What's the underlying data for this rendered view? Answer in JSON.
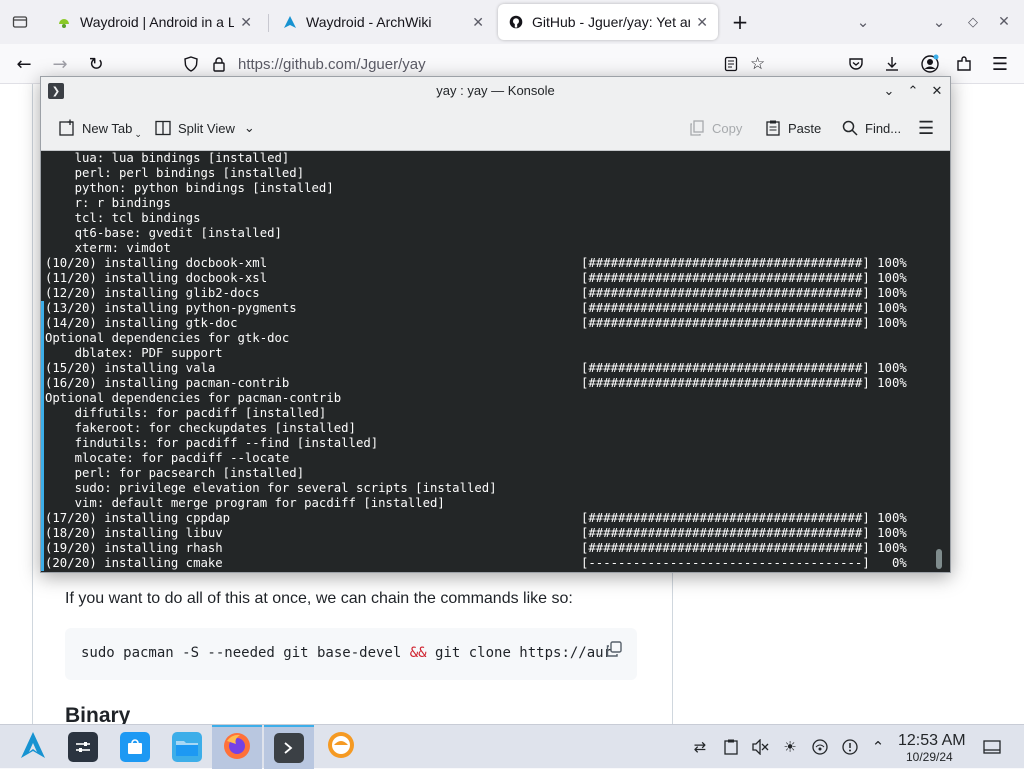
{
  "browser": {
    "tabs": [
      {
        "title": "Waydroid | Android in a Li",
        "favicon": "waydroid-icon",
        "active": false
      },
      {
        "title": "Waydroid - ArchWiki",
        "favicon": "archlinux-icon",
        "active": false
      },
      {
        "title": "GitHub - Jguer/yay: Yet ano",
        "favicon": "github-icon",
        "active": true
      }
    ],
    "url": "https://github.com/Jguer/yay"
  },
  "page": {
    "paragraph": "If you want to do all of this at once, we can chain the commands like so:",
    "code_before": "sudo pacman -S --needed git base-devel ",
    "code_amp": "&&",
    "code_after": " git clone https://aur",
    "heading": "Binary"
  },
  "konsole": {
    "title": "yay : yay — Konsole",
    "toolbar": {
      "new_tab": "New Tab",
      "split_view": "Split View",
      "copy": "Copy",
      "paste": "Paste",
      "find": "Find..."
    },
    "lines": [
      {
        "text": "    lua: lua bindings [installed]",
        "pct": ""
      },
      {
        "text": "    perl: perl bindings [installed]",
        "pct": ""
      },
      {
        "text": "    python: python bindings [installed]",
        "pct": ""
      },
      {
        "text": "    r: r bindings",
        "pct": ""
      },
      {
        "text": "    tcl: tcl bindings",
        "pct": ""
      },
      {
        "text": "    qt6-base: gvedit [installed]",
        "pct": ""
      },
      {
        "text": "    xterm: vimdot",
        "pct": ""
      },
      {
        "text": "(10/20) installing docbook-xml",
        "pct": "[#####################################] 100%"
      },
      {
        "text": "(11/20) installing docbook-xsl",
        "pct": "[#####################################] 100%"
      },
      {
        "text": "(12/20) installing glib2-docs",
        "pct": "[#####################################] 100%"
      },
      {
        "text": "(13/20) installing python-pygments",
        "pct": "[#####################################] 100%"
      },
      {
        "text": "(14/20) installing gtk-doc",
        "pct": "[#####################################] 100%"
      },
      {
        "text": "Optional dependencies for gtk-doc",
        "pct": ""
      },
      {
        "text": "    dblatex: PDF support",
        "pct": ""
      },
      {
        "text": "(15/20) installing vala",
        "pct": "[#####################################] 100%"
      },
      {
        "text": "(16/20) installing pacman-contrib",
        "pct": "[#####################################] 100%"
      },
      {
        "text": "Optional dependencies for pacman-contrib",
        "pct": ""
      },
      {
        "text": "    diffutils: for pacdiff [installed]",
        "pct": ""
      },
      {
        "text": "    fakeroot: for checkupdates [installed]",
        "pct": ""
      },
      {
        "text": "    findutils: for pacdiff --find [installed]",
        "pct": ""
      },
      {
        "text": "    mlocate: for pacdiff --locate",
        "pct": ""
      },
      {
        "text": "    perl: for pacsearch [installed]",
        "pct": ""
      },
      {
        "text": "    sudo: privilege elevation for several scripts [installed]",
        "pct": ""
      },
      {
        "text": "    vim: default merge program for pacdiff [installed]",
        "pct": ""
      },
      {
        "text": "(17/20) installing cppdap",
        "pct": "[#####################################] 100%"
      },
      {
        "text": "(18/20) installing libuv",
        "pct": "[#####################################] 100%"
      },
      {
        "text": "(19/20) installing rhash",
        "pct": "[#####################################] 100%"
      },
      {
        "text": "(20/20) installing cmake",
        "pct": "[-------------------------------------]   0%"
      }
    ]
  },
  "taskbar": {
    "clock_time": "12:53 AM",
    "clock_date": "10/29/24",
    "accent": "#3daee9"
  }
}
